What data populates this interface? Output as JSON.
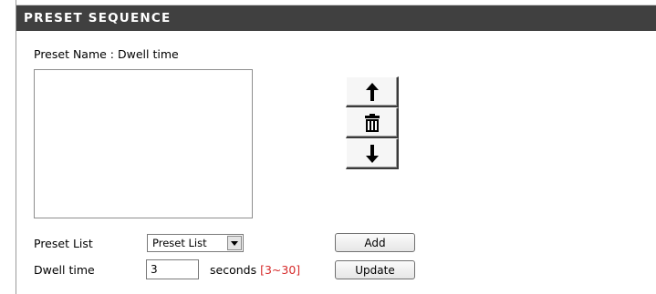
{
  "section": {
    "title": "PRESET SEQUENCE"
  },
  "preset_name": {
    "label": "Preset Name : Dwell time"
  },
  "sequence_list": {
    "items": []
  },
  "controls": {
    "move_up_icon": "up-arrow-icon",
    "delete_icon": "trash-icon",
    "move_down_icon": "down-arrow-icon"
  },
  "preset_list": {
    "label": "Preset List",
    "selected": "Preset List",
    "add_label": "Add"
  },
  "dwell_time": {
    "label": "Dwell time",
    "value": "3",
    "unit": "seconds",
    "range": "[3~30]",
    "update_label": "Update"
  },
  "colors": {
    "header_bg": "#404040",
    "range_text": "#d62a2a"
  }
}
